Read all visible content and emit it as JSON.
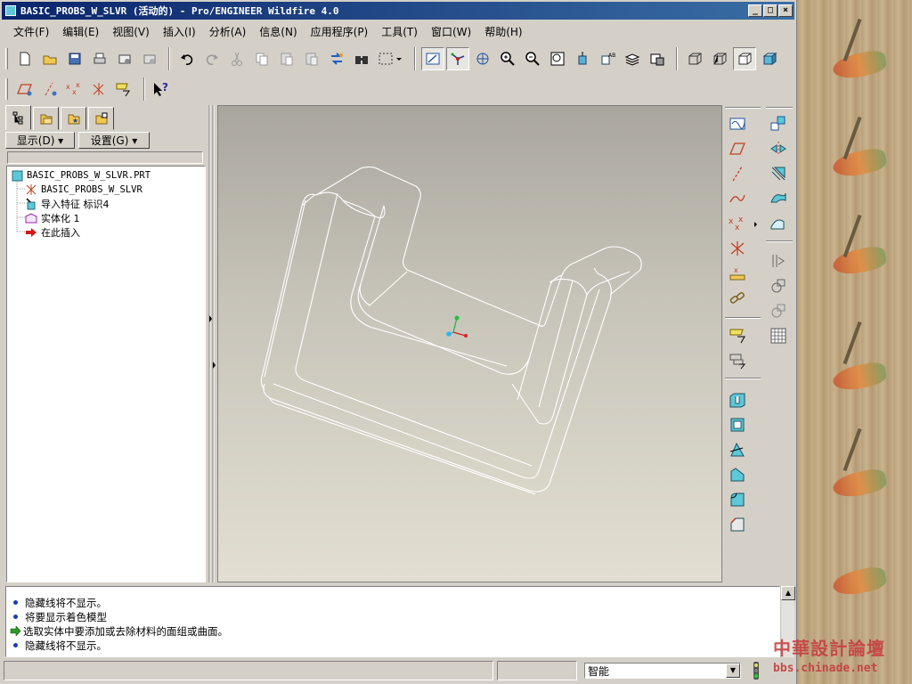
{
  "window": {
    "title": "BASIC_PROBS_W_SLVR (活动的) - Pro/ENGINEER Wildfire 4.0",
    "controls": {
      "minimize": "_",
      "maximize": "□",
      "close": "×"
    }
  },
  "menu": [
    {
      "label": "文件(F)"
    },
    {
      "label": "编辑(E)"
    },
    {
      "label": "视图(V)"
    },
    {
      "label": "插入(I)"
    },
    {
      "label": "分析(A)"
    },
    {
      "label": "信息(N)"
    },
    {
      "label": "应用程序(P)"
    },
    {
      "label": "工具(T)"
    },
    {
      "label": "窗口(W)"
    },
    {
      "label": "帮助(H)"
    }
  ],
  "model_tree": {
    "show_button": "显示(D) ▾",
    "settings_button": "设置(G) ▾",
    "items": [
      {
        "label": "BASIC_PROBS_W_SLVR.PRT",
        "icon": "part-icon"
      },
      {
        "label": "BASIC_PROBS_W_SLVR",
        "icon": "coordinate-system-icon"
      },
      {
        "label": "导入特征 标识4",
        "icon": "import-feature-icon"
      },
      {
        "label": "实体化 1",
        "icon": "solidify-icon"
      },
      {
        "label": "在此插入",
        "icon": "insert-here-arrow-icon"
      }
    ]
  },
  "messages": [
    {
      "text": "隐藏线将不显示。",
      "type": "info"
    },
    {
      "text": "将要显示着色模型",
      "type": "info"
    },
    {
      "text": "选取实体中要添加或去除材料的面组或曲面。",
      "type": "prompt"
    },
    {
      "text": "隐藏线将不显示。",
      "type": "info"
    }
  ],
  "status": {
    "filter_value": "智能"
  },
  "watermark": {
    "name": "中華設計論壇",
    "url": "bbs.chinade.net"
  },
  "colors": {
    "title_start": "#0a246a",
    "title_end": "#3a6ea5",
    "chrome": "#d4d0c8",
    "viewport_top": "#a9a69e",
    "viewport_bottom": "#e2dfd2"
  }
}
